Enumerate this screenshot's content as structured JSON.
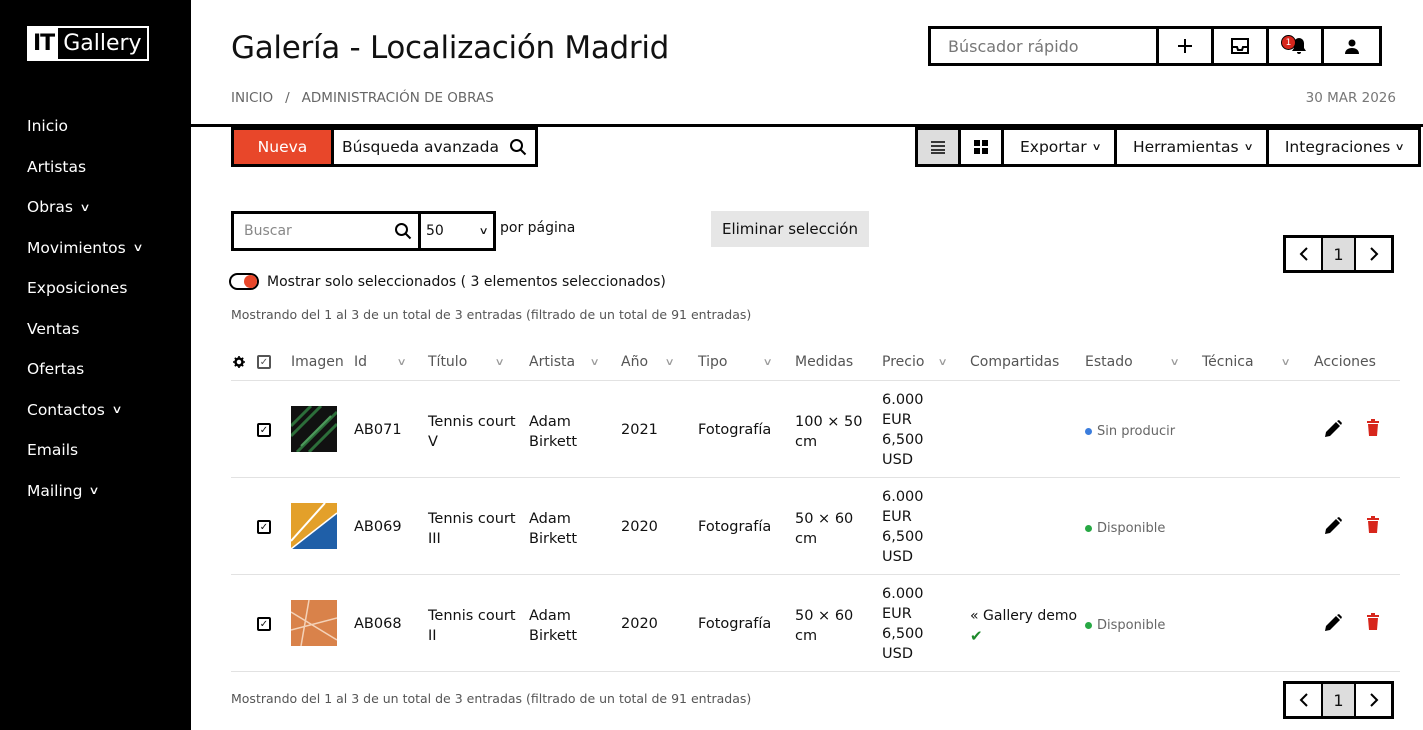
{
  "logo": {
    "left": "IT",
    "right": "Gallery"
  },
  "nav": [
    {
      "label": "Inicio",
      "dropdown": false
    },
    {
      "label": "Artistas",
      "dropdown": false
    },
    {
      "label": "Obras",
      "dropdown": true
    },
    {
      "label": "Movimientos",
      "dropdown": true
    },
    {
      "label": "Exposiciones",
      "dropdown": false
    },
    {
      "label": "Ventas",
      "dropdown": false
    },
    {
      "label": "Ofertas",
      "dropdown": false
    },
    {
      "label": "Contactos",
      "dropdown": true
    },
    {
      "label": "Emails",
      "dropdown": false
    },
    {
      "label": "Mailing",
      "dropdown": true
    }
  ],
  "header": {
    "title": "Galería - Localización Madrid",
    "breadcrumb": [
      "INICIO",
      "/",
      "ADMINISTRACIÓN DE OBRAS"
    ],
    "date": "30 MAR 2026",
    "quick_search_placeholder": "Búscador rápido",
    "notification_count": "1"
  },
  "toolbar": {
    "new_label": "Nueva",
    "advanced_search_label": "Búsqueda avanzada",
    "export_label": "Exportar",
    "tools_label": "Herramientas",
    "integrations_label": "Integraciones"
  },
  "filters": {
    "search_placeholder": "Buscar",
    "per_page_value": "50",
    "per_page_label": "por página",
    "delete_selection_label": "Eliminar selección",
    "toggle_label": "Mostrar solo seleccionados ( 3 elementos seleccionados)",
    "page_number": "1"
  },
  "info_text": "Mostrando del 1 al 3 de un total de 3 entradas (filtrado de un total de 91 entradas)",
  "columns": [
    "Imagen",
    "Id",
    "Título",
    "Artista",
    "Año",
    "Tipo",
    "Medidas",
    "Precio",
    "Compartidas",
    "Estado",
    "Técnica",
    "Acciones"
  ],
  "rows": [
    {
      "id": "AB071",
      "title_l1": "Tennis court",
      "title_l2": "V",
      "artist_l1": "Adam",
      "artist_l2": "Birkett",
      "year": "2021",
      "type": "Fotografía",
      "size_l1": "100 × 50",
      "size_l2": "cm",
      "price": [
        "6.000",
        "EUR",
        "6,500",
        "USD"
      ],
      "shared": "",
      "status": "Sin producir",
      "status_color": "#3b7ddd",
      "thumb": "green"
    },
    {
      "id": "AB069",
      "title_l1": "Tennis court",
      "title_l2": "III",
      "artist_l1": "Adam",
      "artist_l2": "Birkett",
      "year": "2020",
      "type": "Fotografía",
      "size_l1": "50 × 60",
      "size_l2": "cm",
      "price": [
        "6.000",
        "EUR",
        "6,500",
        "USD"
      ],
      "shared": "",
      "status": "Disponible",
      "status_color": "#27a844",
      "thumb": "yellow"
    },
    {
      "id": "AB068",
      "title_l1": "Tennis court",
      "title_l2": "II",
      "artist_l1": "Adam",
      "artist_l2": "Birkett",
      "year": "2020",
      "type": "Fotografía",
      "size_l1": "50 × 60",
      "size_l2": "cm",
      "price": [
        "6.000",
        "EUR",
        "6,500",
        "USD"
      ],
      "shared": "Gallery demo",
      "status": "Disponible",
      "status_color": "#27a844",
      "thumb": "orange"
    }
  ],
  "colors": {
    "accent": "#e8472a",
    "delete": "#d7261c"
  }
}
